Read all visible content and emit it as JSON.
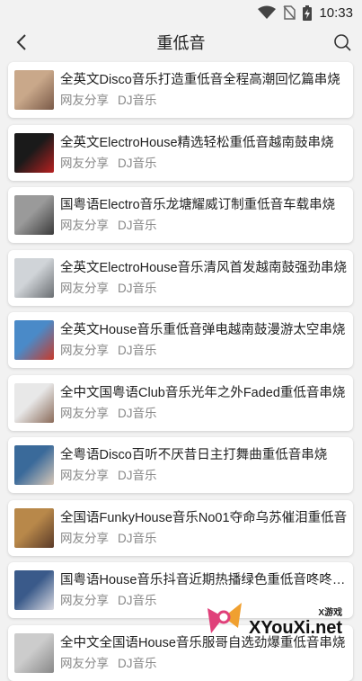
{
  "status_bar": {
    "time": "10:33",
    "icons": [
      "wifi-icon",
      "no-sim-icon",
      "battery-charging-icon"
    ]
  },
  "app_bar": {
    "title": "重低音",
    "back_icon": "back-arrow-icon",
    "search_icon": "search-icon"
  },
  "items": [
    {
      "title": "全英文Disco音乐打造重低音全程高潮回忆篇串烧",
      "source": "网友分享",
      "category": "DJ音乐",
      "thumb_colors": [
        "#c9a88a",
        "#7a5a48"
      ]
    },
    {
      "title": "全英文ElectroHouse精选轻松重低音越南鼓串烧",
      "source": "网友分享",
      "category": "DJ音乐",
      "thumb_colors": [
        "#1a1a1a",
        "#b82020"
      ]
    },
    {
      "title": "国粤语Electro音乐龙塘耀威订制重低音车载串烧",
      "source": "网友分享",
      "category": "DJ音乐",
      "thumb_colors": [
        "#9a9a9a",
        "#3a3a3a"
      ]
    },
    {
      "title": "全英文ElectroHouse音乐清风首发越南鼓强劲串烧",
      "source": "网友分享",
      "category": "DJ音乐",
      "thumb_colors": [
        "#d0d4d8",
        "#6a6e72"
      ]
    },
    {
      "title": "全英文House音乐重低音弹电越南鼓漫游太空串烧",
      "source": "网友分享",
      "category": "DJ音乐",
      "thumb_colors": [
        "#4a8ac8",
        "#c83a2a"
      ]
    },
    {
      "title": "全中文国粤语Club音乐光年之外Faded重低音串烧",
      "source": "网友分享",
      "category": "DJ音乐",
      "thumb_colors": [
        "#e8e8e8",
        "#8a6a58"
      ]
    },
    {
      "title": "全粤语Disco百听不厌昔日主打舞曲重低音串烧",
      "source": "网友分享",
      "category": "DJ音乐",
      "thumb_colors": [
        "#3a6a9a",
        "#d8c8b8"
      ]
    },
    {
      "title": "全国语FunkyHouse音乐No01夺命乌苏催泪重低音",
      "source": "网友分享",
      "category": "DJ音乐",
      "thumb_colors": [
        "#b8884a",
        "#5a3a28"
      ]
    },
    {
      "title": "国粤语House音乐抖音近期热播绿色重低音咚咚串烧",
      "source": "网友分享",
      "category": "DJ音乐",
      "thumb_colors": [
        "#3a5a8a",
        "#d8d8e0"
      ]
    },
    {
      "title": "全中文全国语House音乐服哥自选劲爆重低音串烧",
      "source": "网友分享",
      "category": "DJ音乐",
      "thumb_colors": [
        "#cccccc",
        "#888888"
      ]
    }
  ],
  "watermark": {
    "small": "X游戏",
    "big": "XYouXi.net",
    "colors": [
      "#e0407a",
      "#f0a030"
    ]
  }
}
